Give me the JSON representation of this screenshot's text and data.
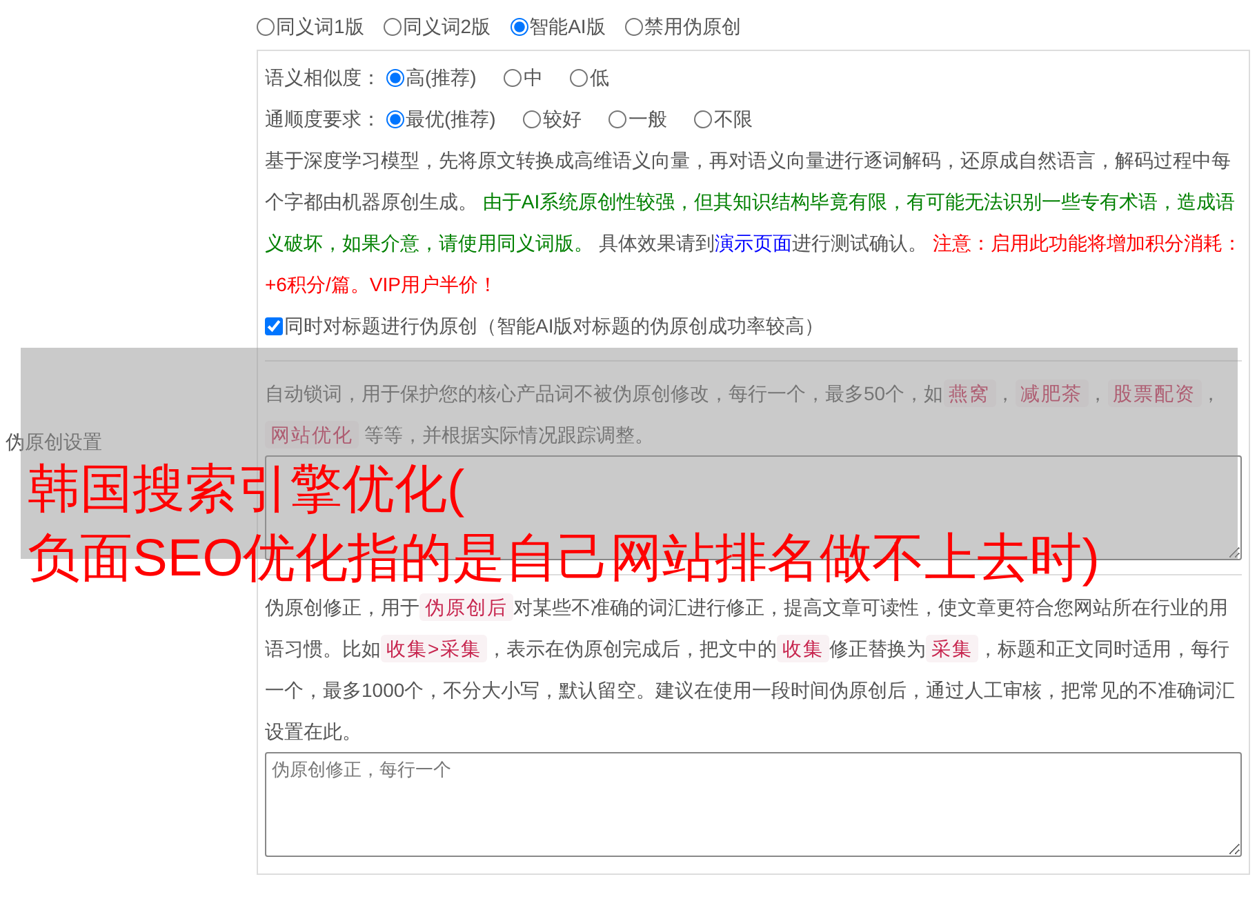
{
  "side_label": "伪原创设置",
  "modes": [
    {
      "label": "同义词1版",
      "selected": false
    },
    {
      "label": "同义词2版",
      "selected": false
    },
    {
      "label": "智能AI版",
      "selected": true
    },
    {
      "label": "禁用伪原创",
      "selected": false
    }
  ],
  "ai_panel": {
    "option_rows": [
      {
        "label": "语义相似度：",
        "options": [
          {
            "label": "高(推荐)",
            "selected": true
          },
          {
            "label": "中",
            "selected": false
          },
          {
            "label": "低",
            "selected": false
          }
        ]
      },
      {
        "label": "通顺度要求：",
        "options": [
          {
            "label": "最优(推荐)",
            "selected": true
          },
          {
            "label": "较好",
            "selected": false
          },
          {
            "label": "一般",
            "selected": false
          },
          {
            "label": "不限",
            "selected": false
          }
        ]
      }
    ],
    "description": [
      {
        "kind": "text",
        "text": "基于深度学习模型，先将原文转换成高维语义向量，再对语义向量进行逐词解码，还原成自然语言，解码过程中每个字都由机器原创生成。 "
      },
      {
        "kind": "green",
        "text": "由于AI系统原创性较强，但其知识结构毕竟有限，有可能无法识别一些专有术语，造成语义破坏，如果介意，请使用同义词版。"
      },
      {
        "kind": "text",
        "text": " 具体效果请到"
      },
      {
        "kind": "link",
        "text": "演示页面"
      },
      {
        "kind": "text",
        "text": "进行测试确认。 "
      },
      {
        "kind": "red",
        "text": "注意：启用此功能将增加积分消耗：+6积分/篇。VIP用户半价！"
      }
    ],
    "title_checkbox": {
      "label": "同时对标题进行伪原创（智能AI版对标题的伪原创成功率较高）",
      "checked": true
    }
  },
  "lock_words": {
    "description": [
      {
        "kind": "text",
        "text": "自动锁词，用于保护您的核心产品词不被伪原创修改，每行一个，最多50个，如"
      },
      {
        "kind": "code",
        "text": "燕窝"
      },
      {
        "kind": "text",
        "text": "，"
      },
      {
        "kind": "code",
        "text": "减肥茶"
      },
      {
        "kind": "text",
        "text": "，"
      },
      {
        "kind": "code",
        "text": "股票配资"
      },
      {
        "kind": "text",
        "text": "，"
      },
      {
        "kind": "code",
        "text": "网站优化"
      },
      {
        "kind": "text",
        "text": " 等等，并根据实际情况跟踪调整。"
      }
    ]
  },
  "correction": {
    "description": [
      {
        "kind": "text",
        "text": "伪原创修正，用于"
      },
      {
        "kind": "code",
        "text": "伪原创后"
      },
      {
        "kind": "text",
        "text": "对某些不准确的词汇进行修正，提高文章可读性，使文章更符合您网站所在行业的用语习惯。比如"
      },
      {
        "kind": "code",
        "text": "收集>采集"
      },
      {
        "kind": "text",
        "text": "，表示在伪原创完成后，把文中的"
      },
      {
        "kind": "code",
        "text": "收集"
      },
      {
        "kind": "text",
        "text": "修正替换为"
      },
      {
        "kind": "code",
        "text": "采集"
      },
      {
        "kind": "text",
        "text": "，标题和正文同时适用，每行一个，最多1000个，不分大小写，默认留空。建议在使用一段时间伪原创后，通过人工审核，把常见的不准确词汇设置在此。"
      }
    ],
    "placeholder": "伪原创修正，每行一个"
  },
  "overlay": {
    "lines": [
      "韩国搜索引擎优化(",
      "负面SEO优化指的是自己网站排名做不上去时)"
    ]
  }
}
